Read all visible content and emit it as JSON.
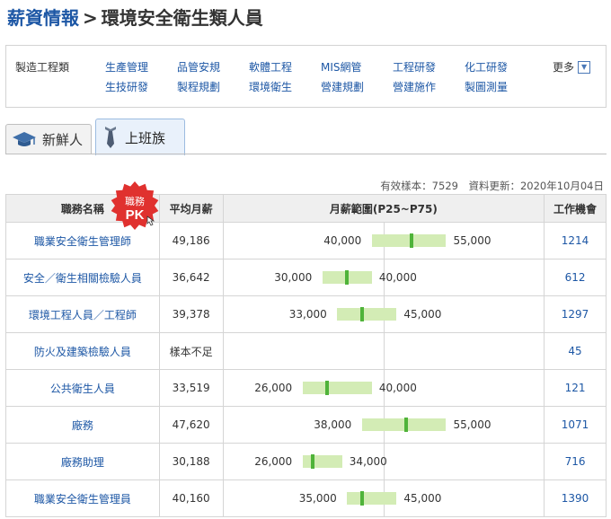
{
  "breadcrumb": {
    "home": "薪資情報",
    "separator": ">",
    "current": "環境安全衛生類人員"
  },
  "category": {
    "label": "製造工程類",
    "links": [
      "生產管理",
      "品管安規",
      "軟體工程",
      "MIS網管",
      "工程研發",
      "化工研發",
      "生技研發",
      "製程規劃",
      "環境衛生",
      "營建規劃",
      "營建施作",
      "製圖測量"
    ],
    "more": "更多"
  },
  "tabs": [
    {
      "label": "新鮮人"
    },
    {
      "label": "上班族"
    }
  ],
  "meta": {
    "text": "有效樣本：7529　資料更新：2020年10月04日"
  },
  "pk_badge": {
    "line1": "職務",
    "line2": "PK"
  },
  "table": {
    "headers": {
      "job": "職務名稱",
      "avg": "平均月薪",
      "range": "月薪範圍(P25~P75)",
      "jobs": "工作機會"
    },
    "rows": [
      {
        "job": "職業安全衛生管理師",
        "avg": "49,186",
        "p25": 40000,
        "p75": 55000,
        "median": 48000,
        "low": "40,000",
        "high": "55,000",
        "count": "1214"
      },
      {
        "job": "安全／衛生相關檢驗人員",
        "avg": "36,642",
        "p25": 30000,
        "p75": 40000,
        "median": 35000,
        "low": "30,000",
        "high": "40,000",
        "count": "612"
      },
      {
        "job": "環境工程人員／工程師",
        "avg": "39,378",
        "p25": 33000,
        "p75": 45000,
        "median": 38000,
        "low": "33,000",
        "high": "45,000",
        "count": "1297"
      },
      {
        "job": "防火及建築檢驗人員",
        "avg": "樣本不足",
        "count": "45"
      },
      {
        "job": "公共衛生人員",
        "avg": "33,519",
        "p25": 26000,
        "p75": 40000,
        "median": 31000,
        "low": "26,000",
        "high": "40,000",
        "count": "121"
      },
      {
        "job": "廠務",
        "avg": "47,620",
        "p25": 38000,
        "p75": 55000,
        "median": 47000,
        "low": "38,000",
        "high": "55,000",
        "count": "1071"
      },
      {
        "job": "廠務助理",
        "avg": "30,188",
        "p25": 26000,
        "p75": 34000,
        "median": 28000,
        "low": "26,000",
        "high": "34,000",
        "count": "716"
      },
      {
        "job": "職業安全衛生管理員",
        "avg": "40,160",
        "p25": 35000,
        "p75": 45000,
        "median": 38000,
        "low": "35,000",
        "high": "45,000",
        "count": "1390"
      }
    ]
  }
}
